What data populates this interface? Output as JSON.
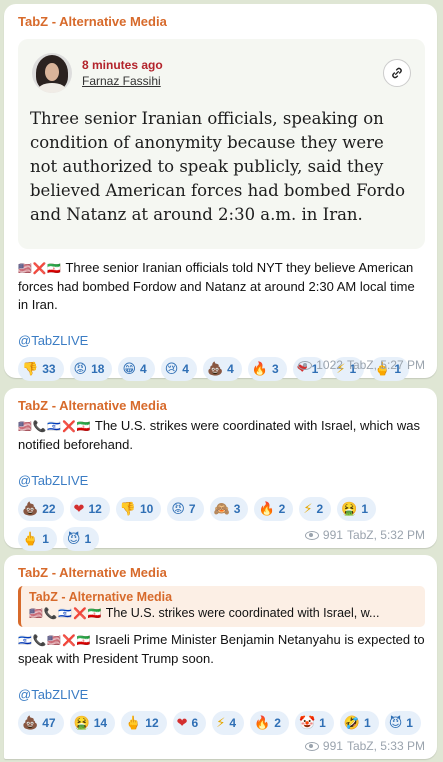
{
  "messages": [
    {
      "channel": "TabZ - Alternative Media",
      "card": {
        "ago": "8 minutes ago",
        "author": "Farnaz Fassihi",
        "quote": "Three senior Iranian officials, speaking on condition of anonymity because they were not authorized to speak publicly, said they believed American forces had bombed Fordo and Natanz at around 2:30 a.m. in Iran."
      },
      "flags": "🇺🇸❌🇮🇷",
      "text": "Three senior Iranian officials told NYT they believe American forces had bombed Fordow and Natanz at around 2:30 AM local time in Iran.",
      "link": "@TabZLIVE",
      "reactions": [
        {
          "emoji": "👎",
          "count": "33"
        },
        {
          "emoji": "😡",
          "count": "18"
        },
        {
          "emoji": "😁",
          "count": "4"
        },
        {
          "emoji": "😢",
          "count": "4"
        },
        {
          "emoji": "💩",
          "count": "4"
        },
        {
          "emoji": "🔥",
          "count": "3"
        },
        {
          "emoji": "❤",
          "count": "1"
        },
        {
          "emoji": "⚡",
          "count": "1"
        },
        {
          "emoji": "🖕",
          "count": "1"
        }
      ],
      "views": "1022",
      "signature": "TabZ, 5:27 PM"
    },
    {
      "channel": "TabZ - Alternative Media",
      "flags": "🇺🇸📞🇮🇱❌🇮🇷",
      "text": "The U.S. strikes were coordinated with Israel, which was notified beforehand.",
      "link": "@TabZLIVE",
      "reactions": [
        {
          "emoji": "💩",
          "count": "22"
        },
        {
          "emoji": "❤",
          "count": "12"
        },
        {
          "emoji": "👎",
          "count": "10"
        },
        {
          "emoji": "😡",
          "count": "7"
        },
        {
          "emoji": "🙈",
          "count": "3"
        },
        {
          "emoji": "🔥",
          "count": "2"
        },
        {
          "emoji": "⚡",
          "count": "2"
        },
        {
          "emoji": "🤮",
          "count": "1"
        },
        {
          "emoji": "🖕",
          "count": "1"
        },
        {
          "emoji": "😈",
          "count": "1"
        }
      ],
      "views": "991",
      "signature": "TabZ, 5:32 PM"
    },
    {
      "channel": "TabZ - Alternative Media",
      "reply": {
        "channel": "TabZ - Alternative Media",
        "flags": "🇺🇸📞🇮🇱❌🇮🇷",
        "text": "The U.S. strikes were coordinated with Israel, w..."
      },
      "flags": "🇮🇱📞🇺🇸❌🇮🇷",
      "text": "Israeli Prime Minister Benjamin Netanyahu is expected to speak with President Trump soon.",
      "link": "@TabZLIVE",
      "reactions": [
        {
          "emoji": "💩",
          "count": "47"
        },
        {
          "emoji": "🤮",
          "count": "14"
        },
        {
          "emoji": "🖕",
          "count": "12"
        },
        {
          "emoji": "❤",
          "count": "6"
        },
        {
          "emoji": "⚡",
          "count": "4"
        },
        {
          "emoji": "🔥",
          "count": "2"
        },
        {
          "emoji": "🤡",
          "count": "1"
        },
        {
          "emoji": "🤣",
          "count": "1"
        },
        {
          "emoji": "😈",
          "count": "1"
        }
      ],
      "views": "991",
      "signature": "TabZ, 5:33 PM"
    }
  ]
}
